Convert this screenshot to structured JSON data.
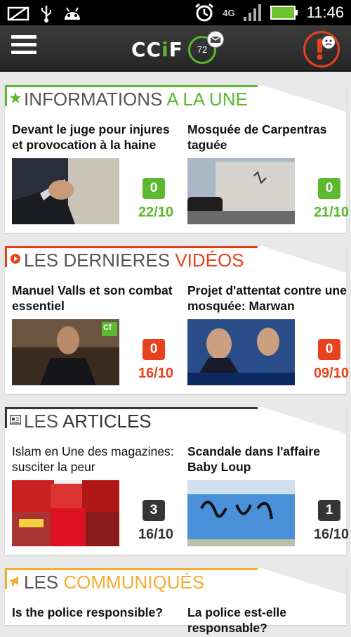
{
  "status": {
    "time": "11:46",
    "network": "4G"
  },
  "app": {
    "logo": "CCiF",
    "logo_main": "CC",
    "logo_i": "i",
    "logo_end": "F",
    "counter": "72"
  },
  "colors": {
    "green": "#5cb82e",
    "red": "#e7421b",
    "dark": "#363636",
    "yellow": "#f6ad2d"
  },
  "sections": [
    {
      "title_a": "INFORMATIONS",
      "title_b": "A LA UNE",
      "accent": "#5cb82e",
      "icon": "star-icon",
      "items": [
        {
          "headline": "Devant le juge pour injures et provocation à la haine",
          "comments": "0",
          "date": "22/10"
        },
        {
          "headline": "Mosquée de Carpentras taguée",
          "comments": "0",
          "date": "21/10"
        }
      ]
    },
    {
      "title_a": "LES DERNIERES",
      "title_b": "VIDÉOS",
      "accent": "#e7421b",
      "icon": "play-icon",
      "items": [
        {
          "headline": "Manuel Valls et son combat essentiel",
          "comments": "0",
          "date": "16/10",
          "badge": "Cf"
        },
        {
          "headline": "Projet d'attentat contre une mosquée: Marwan",
          "comments": "0",
          "date": "09/10"
        }
      ]
    },
    {
      "title_a": "LES",
      "title_b": "ARTICLES",
      "accent": "#363636",
      "icon": "newspaper-icon",
      "items": [
        {
          "headline": "Islam en Une des magazines: susciter la peur",
          "comments": "3",
          "date": "16/10"
        },
        {
          "headline": "Scandale dans l'affaire Baby Loup",
          "comments": "1",
          "date": "16/10"
        }
      ]
    },
    {
      "title_a": "LES",
      "title_b": "COMMUNIQUÉS",
      "accent": "#f6ad2d",
      "icon": "megaphone-icon",
      "items": [
        {
          "headline": "Is the police responsible?"
        },
        {
          "headline": "La police est-elle responsable?"
        }
      ]
    }
  ]
}
